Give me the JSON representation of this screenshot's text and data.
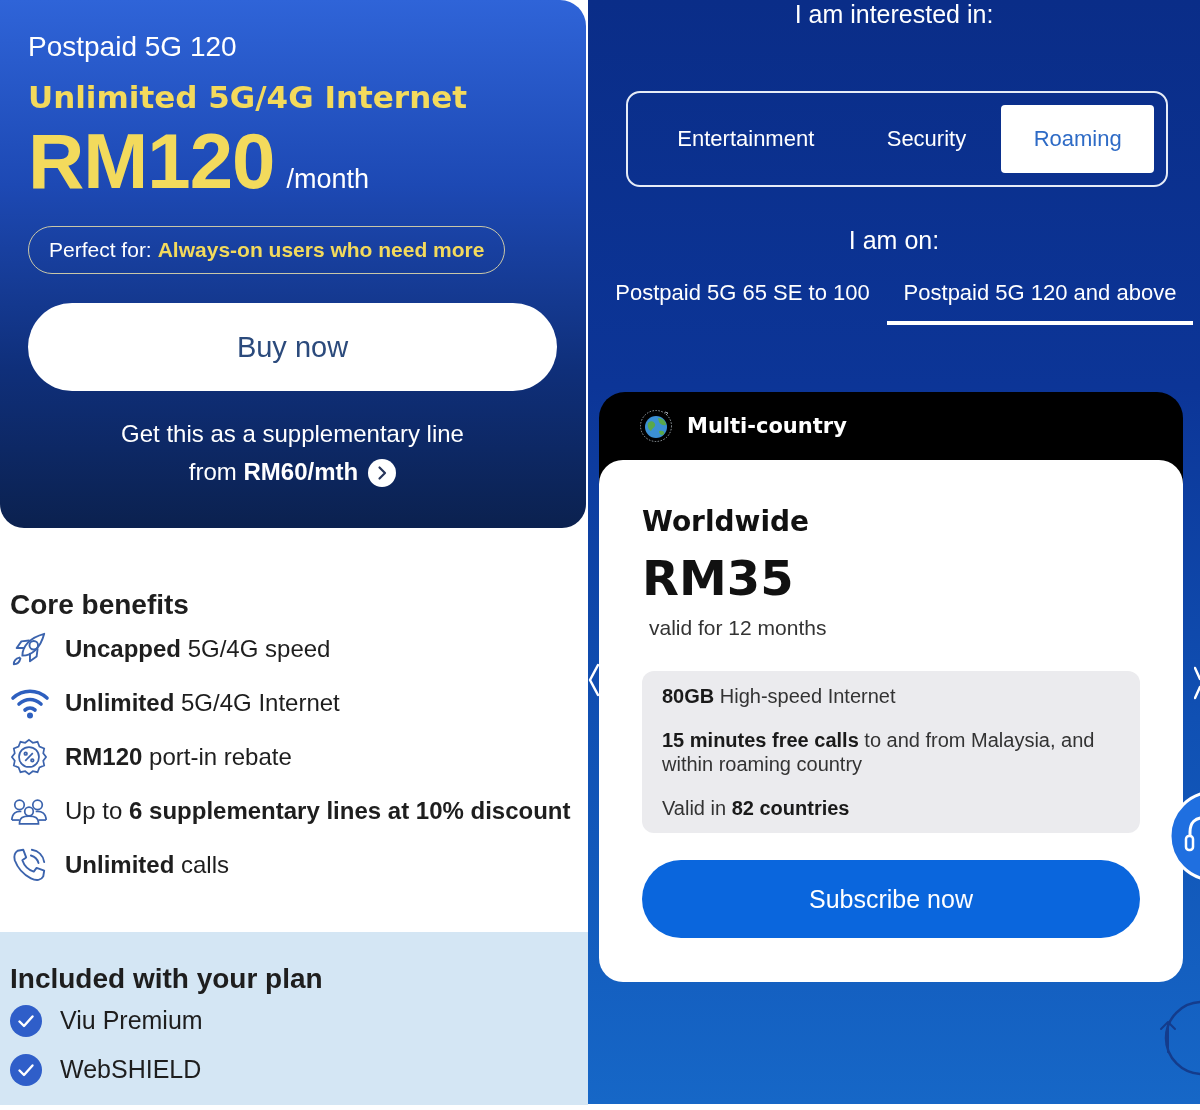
{
  "plan_card": {
    "plan_name": "Postpaid 5G 120",
    "headline": "Unlimited 5G/4G Internet",
    "price": "RM120",
    "period": "/month",
    "perfect_for": "Perfect for: **Always-on users who need more**",
    "buy_button": "Buy now",
    "supplementary_link": "Get this as a supplementary line from **RM60/mth**"
  },
  "core_benefits": {
    "title": "Core benefits",
    "items": [
      {
        "kind": "speed",
        "text": "**Uncapped** 5G/4G speed"
      },
      {
        "kind": "internet",
        "text": "**Unlimited** 5G/4G Internet"
      },
      {
        "kind": "rebate",
        "text": "**RM120** port-in rebate"
      },
      {
        "kind": "lines",
        "text": "Up to **6 supplementary lines at 10% discount**"
      },
      {
        "kind": "calls",
        "text": "**Unlimited** calls"
      }
    ]
  },
  "included": {
    "title": "Included with your plan",
    "items": [
      {
        "text": "Viu Premium",
        "checked": true
      },
      {
        "text": "WebSHIELD",
        "checked": true
      }
    ]
  },
  "interest": {
    "label": "I am interested in:",
    "options": [
      {
        "label": "Entertainment",
        "selected": false
      },
      {
        "label": "Security",
        "selected": false
      },
      {
        "label": "Roaming",
        "selected": true
      }
    ]
  },
  "plan_filter": {
    "label": "I am on:",
    "tabs": [
      {
        "label": "Postpaid 5G 65 SE to 100",
        "selected": false
      },
      {
        "label": "Postpaid 5G 120 and above",
        "selected": true
      }
    ]
  },
  "pass_card": {
    "category": "Multi-country",
    "pass_name": "Worldwide",
    "price": "RM35",
    "validity": "valid for 12 months",
    "features": [
      "**80GB** High-speed Internet",
      "**15 minutes free calls** to and from Malaysia, and within roaming country",
      "Valid in **82 countries**"
    ],
    "button": "Subscribe now"
  }
}
